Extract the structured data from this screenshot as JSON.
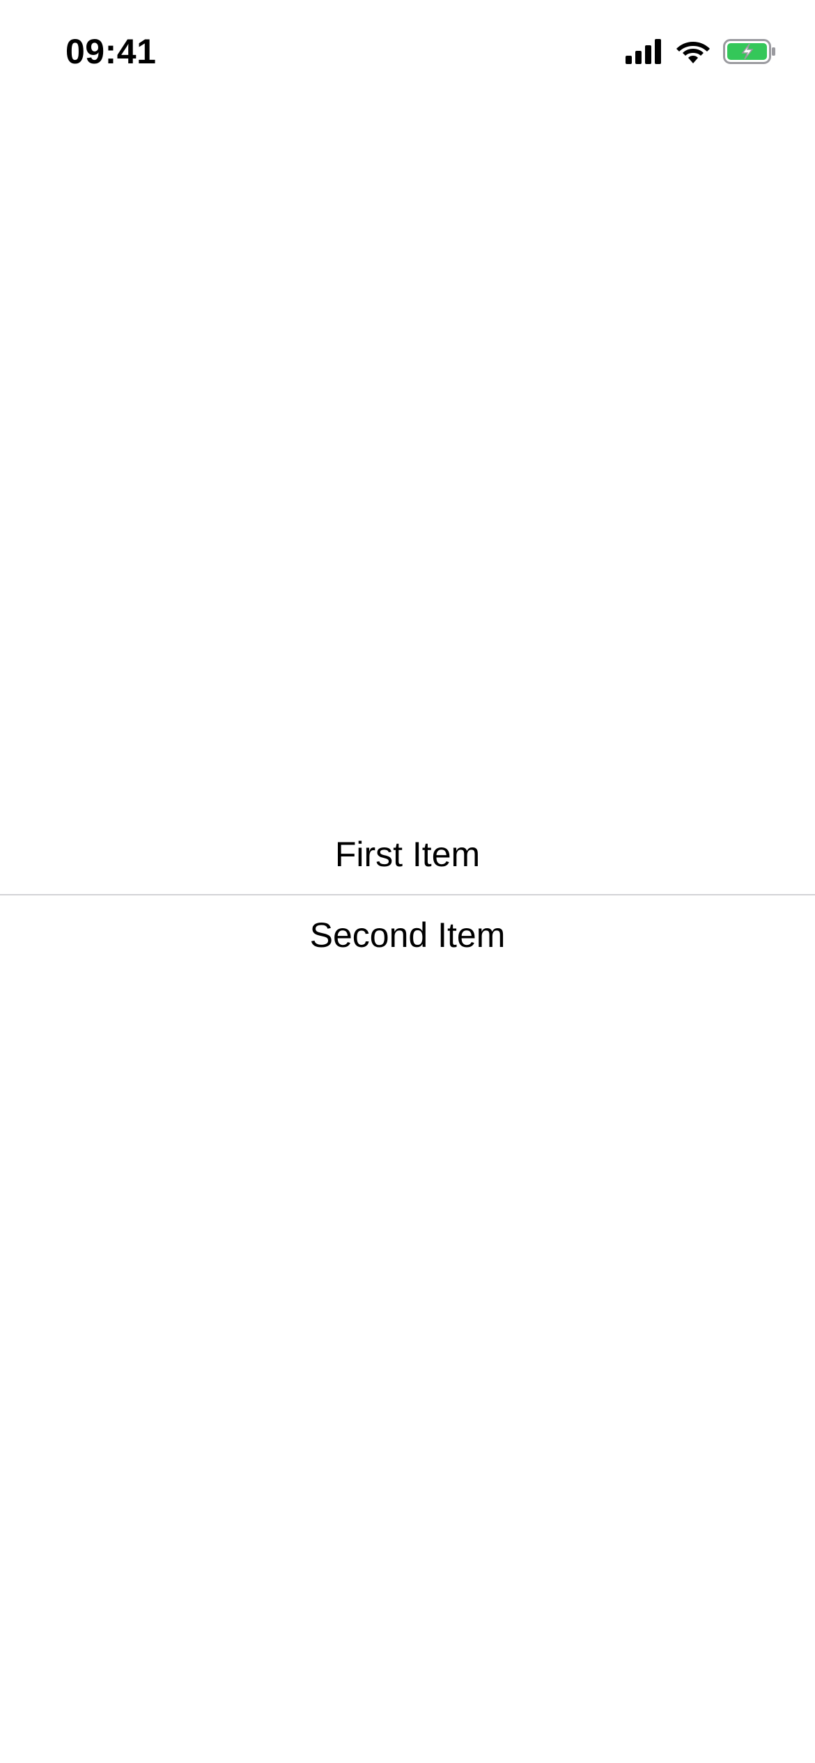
{
  "status_bar": {
    "time": "09:41",
    "icons": [
      "cellular-signal-icon",
      "wifi-icon",
      "battery-charging-icon"
    ],
    "battery_color": "#34c759"
  },
  "list": {
    "items": [
      {
        "label": "First Item"
      },
      {
        "label": "Second Item"
      }
    ],
    "separator_color": "#d2d2d6"
  }
}
